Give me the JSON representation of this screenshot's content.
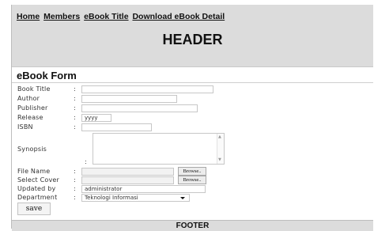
{
  "nav": {
    "items": [
      "Home",
      "Members",
      "eBook Title",
      "Download eBook Detail"
    ]
  },
  "header": {
    "title": "HEADER"
  },
  "form": {
    "title": "eBook Form",
    "fields": {
      "book_title": {
        "label": "Book Title",
        "value": ""
      },
      "author": {
        "label": "Author",
        "value": ""
      },
      "publisher": {
        "label": "Publisher",
        "value": ""
      },
      "release": {
        "label": "Release",
        "value": "yyyy"
      },
      "isbn": {
        "label": "ISBN",
        "value": ""
      },
      "synopsis": {
        "label": "Synopsis",
        "value": ""
      },
      "file_name": {
        "label": "File Name",
        "value": "",
        "button": "Browse.."
      },
      "select_cover": {
        "label": "Select Cover",
        "value": "",
        "button": "Browse.."
      },
      "updated_by": {
        "label": "Updated by",
        "value": "administrator"
      },
      "department": {
        "label": "Department",
        "value": "Teknologi Informasi"
      }
    },
    "colon": ":",
    "save_label": "save"
  },
  "footer": {
    "text": "FOOTER"
  }
}
